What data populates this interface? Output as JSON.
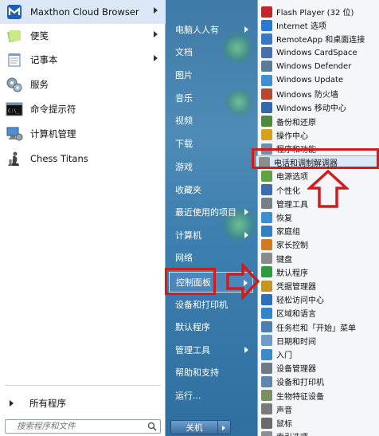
{
  "left_panel": {
    "items": [
      {
        "label": "Maxthon Cloud Browser",
        "icon": "maxthon-icon",
        "has_arrow": true
      },
      {
        "label": "便笺",
        "icon": "sticky-notes-icon",
        "has_arrow": true
      },
      {
        "label": "记事本",
        "icon": "notepad-icon",
        "has_arrow": true
      },
      {
        "label": "服务",
        "icon": "services-gear-icon",
        "has_arrow": false
      },
      {
        "label": "命令提示符",
        "icon": "cmd-icon",
        "has_arrow": false
      },
      {
        "label": "计算机管理",
        "icon": "computer-management-icon",
        "has_arrow": false
      },
      {
        "label": "Chess Titans",
        "icon": "chess-icon",
        "has_arrow": false
      }
    ],
    "all_programs": "所有程序",
    "search_placeholder": "搜索程序和文件"
  },
  "mid_panel": {
    "items": [
      {
        "label": "电脑人人有",
        "has_arrow": true
      },
      {
        "label": "文档",
        "has_arrow": false
      },
      {
        "label": "图片",
        "has_arrow": false
      },
      {
        "label": "音乐",
        "has_arrow": false
      },
      {
        "label": "视频",
        "has_arrow": false
      },
      {
        "label": "下载",
        "has_arrow": false
      },
      {
        "label": "游戏",
        "has_arrow": false
      },
      {
        "label": "收藏夹",
        "has_arrow": false
      },
      {
        "label": "最近使用的项目",
        "has_arrow": true
      },
      {
        "label": "计算机",
        "has_arrow": true
      },
      {
        "label": "网络",
        "has_arrow": false
      },
      {
        "label": "控制面板",
        "has_arrow": true
      },
      {
        "label": "设备和打印机",
        "has_arrow": false
      },
      {
        "label": "默认程序",
        "has_arrow": false
      },
      {
        "label": "管理工具",
        "has_arrow": true
      },
      {
        "label": "帮助和支持",
        "has_arrow": false
      },
      {
        "label": "运行...",
        "has_arrow": false
      }
    ],
    "shutdown_label": "关机"
  },
  "submenu": {
    "items": [
      {
        "label": "Flash Player (32 位)",
        "color": "#c0262b"
      },
      {
        "label": "Internet 选项",
        "color": "#2a7bd0"
      },
      {
        "label": "RemoteApp 和桌面连接",
        "color": "#3a78c4"
      },
      {
        "label": "Windows CardSpace",
        "color": "#4a6fb0"
      },
      {
        "label": "Windows Defender",
        "color": "#5b7c99"
      },
      {
        "label": "Windows Update",
        "color": "#3f8fd6"
      },
      {
        "label": "Windows 防火墙",
        "color": "#b5482d"
      },
      {
        "label": "Windows 移动中心",
        "color": "#3568a8"
      },
      {
        "label": "备份和还原",
        "color": "#4d8a3c"
      },
      {
        "label": "操作中心",
        "color": "#d6a21e"
      },
      {
        "label": "程序和功能",
        "color": "#6b8fb5"
      },
      {
        "label": "电话和调制解调器",
        "color": "#8d8d8d"
      },
      {
        "label": "电源选项",
        "color": "#5fa341"
      },
      {
        "label": "个性化",
        "color": "#3b6db1"
      },
      {
        "label": "管理工具",
        "color": "#7a7f87"
      },
      {
        "label": "恢复",
        "color": "#3d8ed0"
      },
      {
        "label": "家庭组",
        "color": "#2f7fc2"
      },
      {
        "label": "家长控制",
        "color": "#d17a22"
      },
      {
        "label": "键盘",
        "color": "#8a8a8a"
      },
      {
        "label": "默认程序",
        "color": "#2f9a3c"
      },
      {
        "label": "凭据管理器",
        "color": "#c5951f"
      },
      {
        "label": "轻松访问中心",
        "color": "#2c6fbe"
      },
      {
        "label": "区域和语言",
        "color": "#3384c8"
      },
      {
        "label": "任务栏和「开始」菜单",
        "color": "#4f7fb2"
      },
      {
        "label": "日期和时间",
        "color": "#6d9cc9"
      },
      {
        "label": "入门",
        "color": "#3a89c9"
      },
      {
        "label": "设备管理器",
        "color": "#6f7b88"
      },
      {
        "label": "设备和打印机",
        "color": "#5f86ad"
      },
      {
        "label": "生物特征设备",
        "color": "#7c8f63"
      },
      {
        "label": "声音",
        "color": "#7b7b7b"
      },
      {
        "label": "鼠标",
        "color": "#6a6a6a"
      },
      {
        "label": "索引选项",
        "color": "#8a8f96"
      }
    ],
    "highlighted_index": 11
  },
  "colors": {
    "annotation_red": "#d11c1c",
    "mid_panel_blue": "#3f7aa8"
  }
}
